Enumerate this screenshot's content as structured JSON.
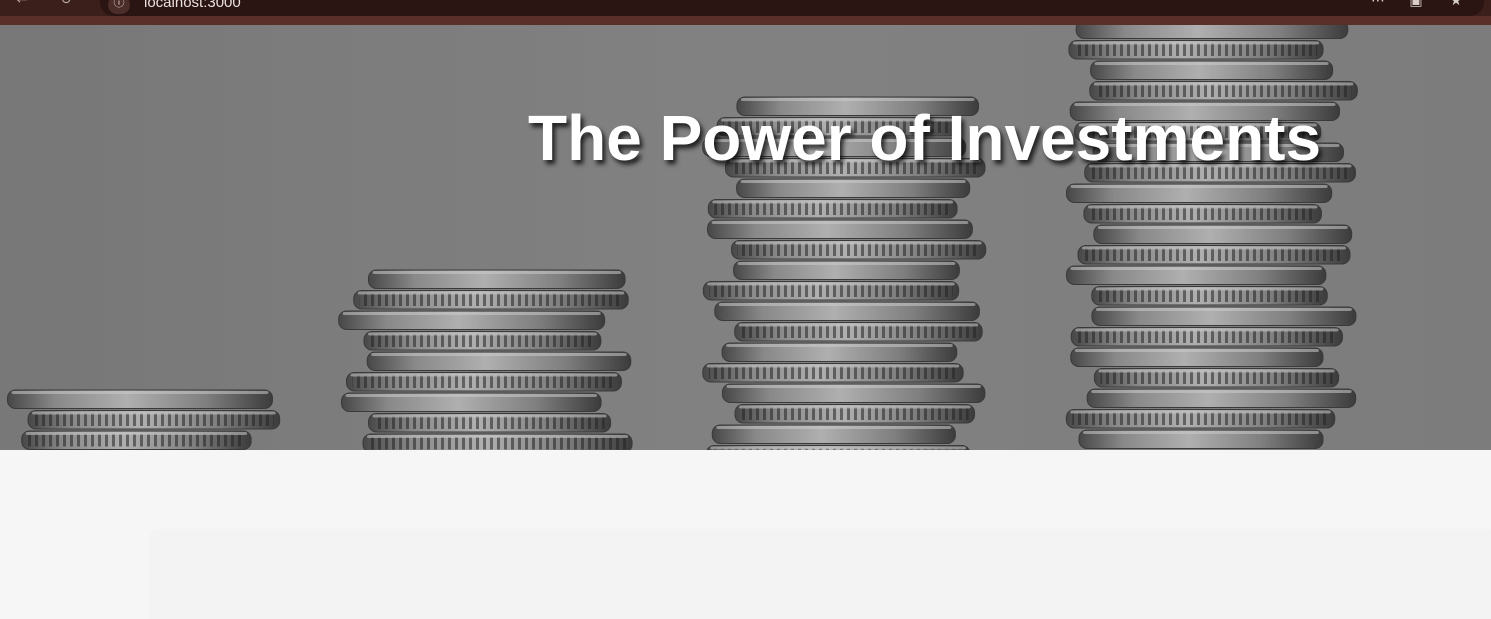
{
  "browser": {
    "url": "localhost:3000",
    "back_icon": "←",
    "reload_icon": "↻",
    "site_info_icon": "ⓘ",
    "toolbar_icons": [
      "⋯",
      "▣",
      "★"
    ]
  },
  "hero": {
    "title": "The Power of Investments",
    "background_image": "stacked-coins"
  },
  "colors": {
    "browser_bar": "#3a1f1b",
    "hero_overlay": "#8b8b8b",
    "page_background": "#f6f6f6",
    "title_text": "#ffffff"
  }
}
